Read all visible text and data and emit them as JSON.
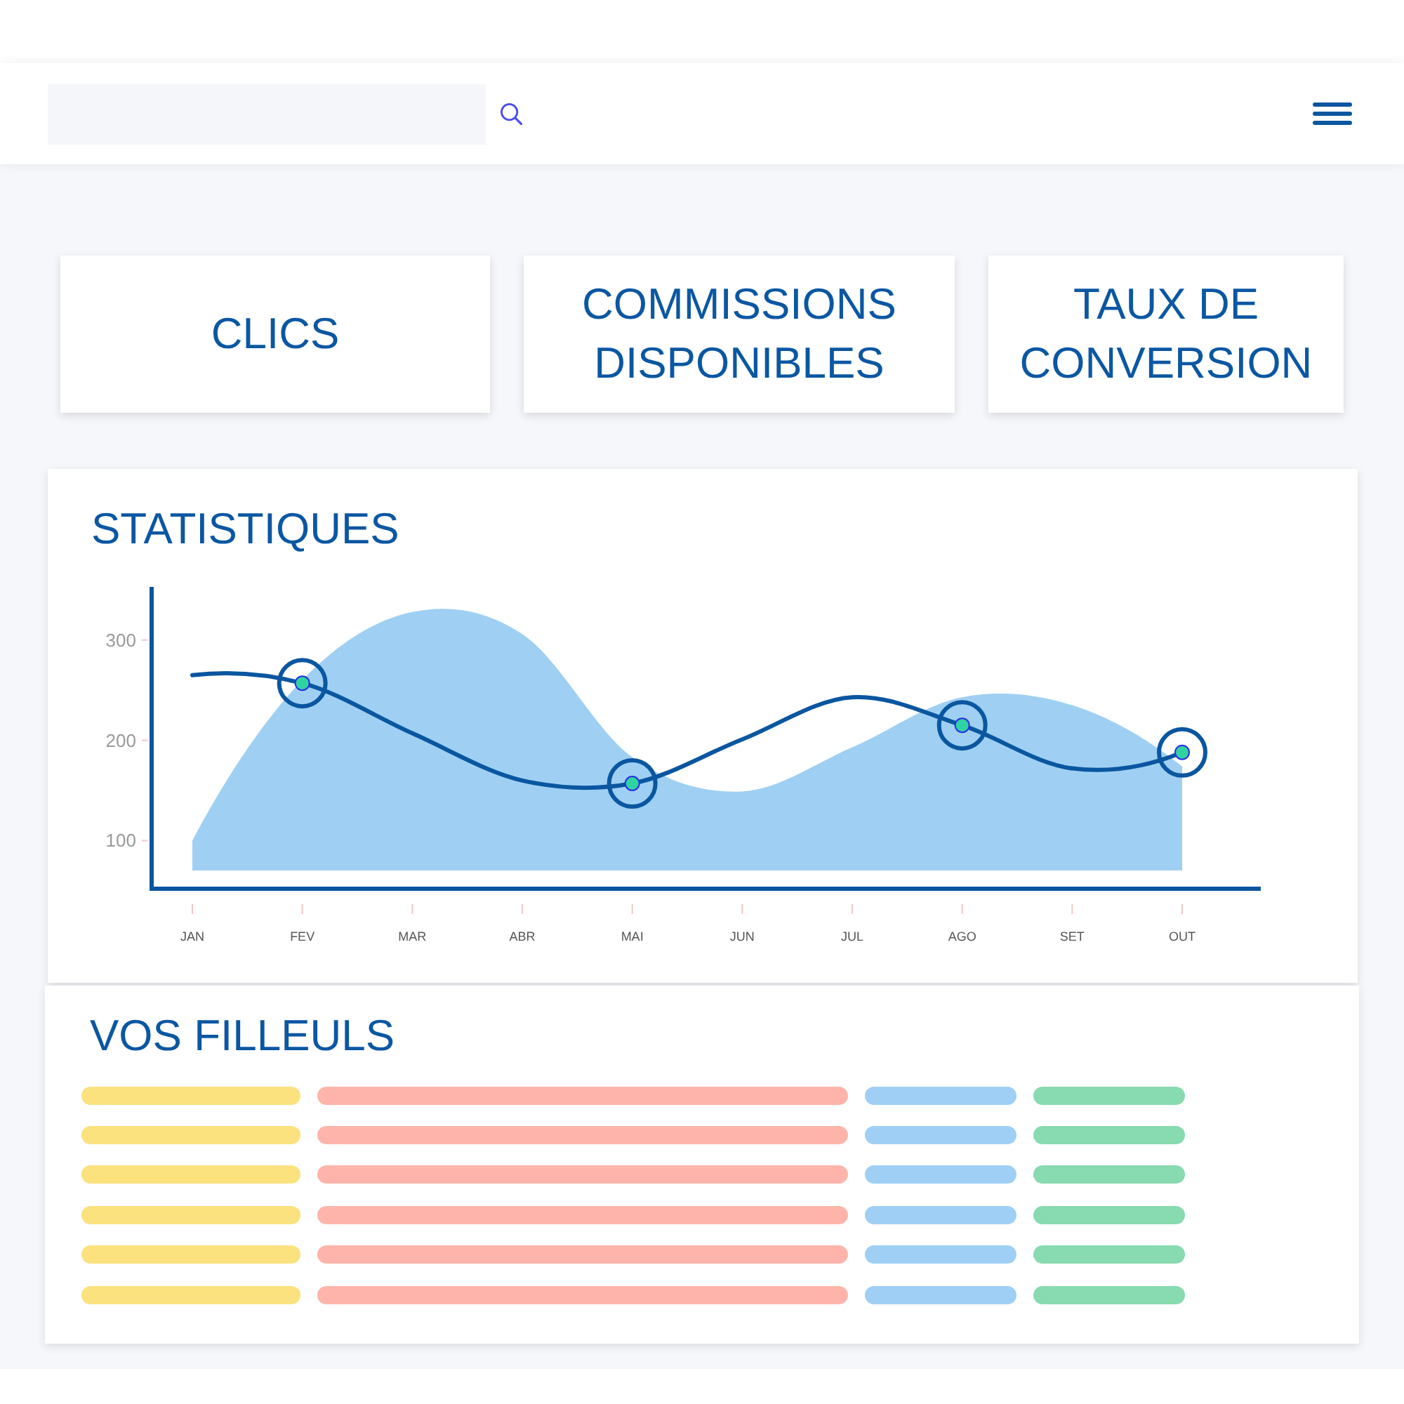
{
  "summary_cards": [
    {
      "label": "CLICS"
    },
    {
      "label": "COMMISSIONS DISPONIBLES"
    },
    {
      "label": "TAUX DE CONVERSION"
    }
  ],
  "statistics": {
    "title": "STATISTIQUES",
    "chart_data": {
      "type": "area",
      "categories": [
        "JAN",
        "FEV",
        "MAR",
        "ABR",
        "MAI",
        "JUN",
        "JUL",
        "AGO",
        "SET",
        "OUT"
      ],
      "ylim": [
        52,
        353
      ],
      "yticks": [
        100,
        200,
        300
      ],
      "series": [
        {
          "type": "area",
          "color": "#9fd0f3",
          "values": [
            100,
            260,
            328,
            306,
            183,
            149,
            193,
            243,
            235,
            174
          ]
        },
        {
          "type": "line",
          "color": "#0a56a0",
          "values": [
            265,
            257,
            207,
            160,
            157,
            201,
            243,
            215,
            172,
            188
          ]
        },
        {
          "type": "scatter",
          "color": "#2fd3a2",
          "values": [
            null,
            257,
            null,
            null,
            157,
            null,
            null,
            215,
            null,
            188
          ]
        }
      ]
    }
  },
  "referrals": {
    "title": "VOS FILLEULS",
    "rows": [
      {
        "cells": [
          {
            "color": "#fbe27e"
          },
          {
            "color": "#feb4aa"
          },
          {
            "color": "#9fcff5"
          },
          {
            "color": "#88dab0"
          }
        ]
      },
      {
        "cells": [
          {
            "color": "#fbe27e"
          },
          {
            "color": "#feb4aa"
          },
          {
            "color": "#9fcff5"
          },
          {
            "color": "#88dab0"
          }
        ]
      },
      {
        "cells": [
          {
            "color": "#fbe27e"
          },
          {
            "color": "#feb4aa"
          },
          {
            "color": "#9fcff5"
          },
          {
            "color": "#88dab0"
          }
        ]
      },
      {
        "cells": [
          {
            "color": "#fbe27e"
          },
          {
            "color": "#feb4aa"
          },
          {
            "color": "#9fcff5"
          },
          {
            "color": "#88dab0"
          }
        ]
      },
      {
        "cells": [
          {
            "color": "#fbe27e"
          },
          {
            "color": "#feb4aa"
          },
          {
            "color": "#9fcff5"
          },
          {
            "color": "#88dab0"
          }
        ]
      },
      {
        "cells": [
          {
            "color": "#fbe27e"
          },
          {
            "color": "#feb4aa"
          },
          {
            "color": "#9fcff5"
          },
          {
            "color": "#88dab0"
          }
        ]
      }
    ]
  }
}
